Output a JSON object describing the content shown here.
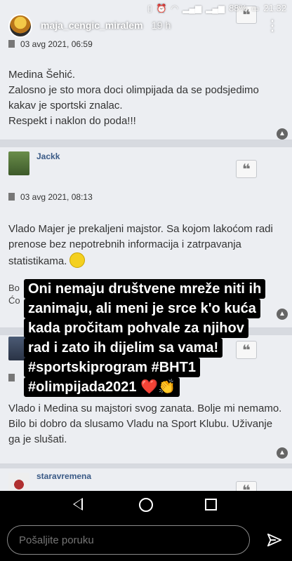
{
  "status_bar": {
    "left": "",
    "battery": "88%",
    "time": "21:32"
  },
  "story": {
    "username": "maja_cengic_miralem",
    "time_ago": "19 h"
  },
  "posts": [
    {
      "date": "03 avg 2021, 06:59",
      "lines": [
        "Medina Šehić.",
        "Zalosno je sto mora doci olimpijada da se podsjedimo",
        "kakav je sportski znalac.",
        "Respekt i naklon do poda!!!"
      ]
    },
    {
      "author": "Jackk",
      "date": "03 avg 2021, 08:13",
      "lines": [
        "Vlado Majer je prekaljeni majstor. Sa kojom lakoćom radi",
        "prenose bez nepotrebnih informacija i zatrpavanja",
        "statistikama."
      ],
      "partial_lines": [
        "Bo",
        "Ćo"
      ]
    },
    {
      "date": "",
      "lines": [
        "Vlado i Medina su majstori svog zanata. Bolje mi nemamo.",
        "Bilo bi dobro da slusamo Vladu na Sport Klubu. Uživanje",
        "ga je slušati."
      ]
    },
    {
      "author": "staravremena"
    }
  ],
  "caption": {
    "lines": [
      "Oni nemaju društvene mreže niti ih",
      "zanimaju, ali meni je srce k'o kuća",
      "kada pročitam pohvale za njihov",
      "rad i zato ih dijelim sa vama!",
      "#sportskiprogram #BHT1",
      "#olimpijada2021"
    ],
    "emoji": "❤️👏"
  },
  "reply": {
    "placeholder": "Pošaljite poruku"
  },
  "icons": {
    "quote": "quote-icon",
    "up": "arrow-up-icon",
    "send": "send-icon",
    "more": "more-vertical-icon"
  },
  "colors": {
    "author_name": "#3a5a86",
    "heart": "#e0232b"
  }
}
